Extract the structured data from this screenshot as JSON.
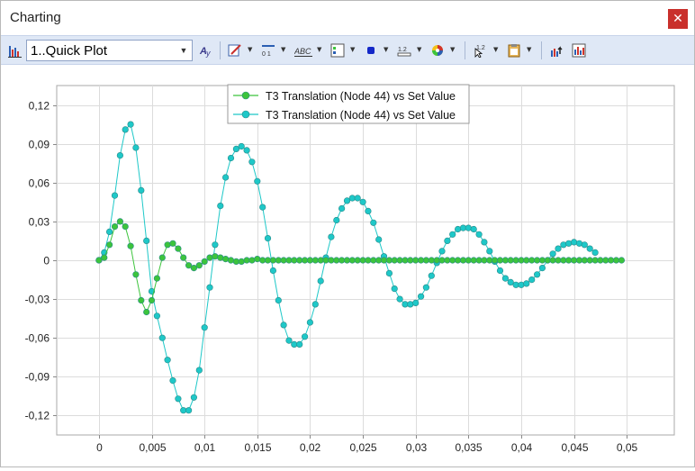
{
  "window": {
    "title": "Charting",
    "close_glyph": "✕"
  },
  "toolbar": {
    "chart_icon": "bar-chart-icon",
    "plot_select_value": "1..Quick Plot",
    "tools": [
      "font-style-icon",
      "edit-series-icon",
      "axis-format-icon",
      "abc-labels-icon",
      "legend-icon",
      "marker-style-icon",
      "number-format-icon",
      "color-palette-icon",
      "data-cursor-icon",
      "clipboard-icon",
      "export-icon",
      "chart-settings-icon"
    ]
  },
  "chart_data": {
    "type": "line",
    "xlim": [
      -0.004,
      0.0545
    ],
    "ylim": [
      -0.135,
      0.135
    ],
    "grid": true,
    "legend_position": "top-center",
    "x_ticks": [
      "0",
      "0,005",
      "0,01",
      "0,015",
      "0,02",
      "0,025",
      "0,03",
      "0,035",
      "0,04",
      "0,045",
      "0,05"
    ],
    "y_ticks": [
      "0,12",
      "0,09",
      "0,06",
      "0,03",
      "0",
      "-0,03",
      "-0,06",
      "-0,09",
      "-0,12"
    ],
    "series": [
      {
        "name": "T3 Translation (Node 44) vs Set Value",
        "color": "#3cc43c",
        "points": [
          [
            0,
            0
          ],
          [
            0.0005,
            0.002
          ],
          [
            0.001,
            0.012
          ],
          [
            0.0015,
            0.026
          ],
          [
            0.002,
            0.03
          ],
          [
            0.0025,
            0.026
          ],
          [
            0.003,
            0.011
          ],
          [
            0.0035,
            -0.011
          ],
          [
            0.004,
            -0.031
          ],
          [
            0.0045,
            -0.04
          ],
          [
            0.005,
            -0.031
          ],
          [
            0.0055,
            -0.014
          ],
          [
            0.006,
            0.002
          ],
          [
            0.0065,
            0.012
          ],
          [
            0.007,
            0.013
          ],
          [
            0.0075,
            0.009
          ],
          [
            0.008,
            0.002
          ],
          [
            0.0085,
            -0.004
          ],
          [
            0.009,
            -0.006
          ],
          [
            0.0095,
            -0.004
          ],
          [
            0.01,
            -0.001
          ],
          [
            0.0105,
            0.002
          ],
          [
            0.011,
            0.003
          ],
          [
            0.0115,
            0.002
          ],
          [
            0.012,
            0.001
          ],
          [
            0.0125,
            0
          ],
          [
            0.013,
            -0.001
          ],
          [
            0.0135,
            -0.001
          ],
          [
            0.014,
            0
          ],
          [
            0.0145,
            0
          ],
          [
            0.015,
            0.001
          ],
          [
            0.0155,
            0
          ],
          [
            0.016,
            0
          ],
          [
            0.0165,
            0
          ],
          [
            0.017,
            0
          ],
          [
            0.0175,
            0
          ],
          [
            0.018,
            0
          ],
          [
            0.0185,
            0
          ],
          [
            0.019,
            0
          ],
          [
            0.0195,
            0
          ],
          [
            0.02,
            0
          ],
          [
            0.0205,
            0
          ],
          [
            0.021,
            0
          ],
          [
            0.0215,
            0
          ],
          [
            0.022,
            0
          ],
          [
            0.0225,
            0
          ],
          [
            0.023,
            0
          ],
          [
            0.0235,
            0
          ],
          [
            0.024,
            0
          ],
          [
            0.0245,
            0
          ],
          [
            0.025,
            0
          ],
          [
            0.0255,
            0
          ],
          [
            0.026,
            0
          ],
          [
            0.0265,
            0
          ],
          [
            0.027,
            0
          ],
          [
            0.0275,
            0
          ],
          [
            0.028,
            0
          ],
          [
            0.0285,
            0
          ],
          [
            0.029,
            0
          ],
          [
            0.0295,
            0
          ],
          [
            0.03,
            0
          ],
          [
            0.0305,
            0
          ],
          [
            0.031,
            0
          ],
          [
            0.0315,
            0
          ],
          [
            0.032,
            0
          ],
          [
            0.0325,
            0
          ],
          [
            0.033,
            0
          ],
          [
            0.0335,
            0
          ],
          [
            0.034,
            0
          ],
          [
            0.0345,
            0
          ],
          [
            0.035,
            0
          ],
          [
            0.0355,
            0
          ],
          [
            0.036,
            0
          ],
          [
            0.0365,
            0
          ],
          [
            0.037,
            0
          ],
          [
            0.0375,
            0
          ],
          [
            0.038,
            0
          ],
          [
            0.0385,
            0
          ],
          [
            0.039,
            0
          ],
          [
            0.0395,
            0
          ],
          [
            0.04,
            0
          ],
          [
            0.0405,
            0
          ],
          [
            0.041,
            0
          ],
          [
            0.0415,
            0
          ],
          [
            0.042,
            0
          ],
          [
            0.0425,
            0
          ],
          [
            0.043,
            0
          ],
          [
            0.0435,
            0
          ],
          [
            0.044,
            0
          ],
          [
            0.0445,
            0
          ],
          [
            0.045,
            0
          ],
          [
            0.0455,
            0
          ],
          [
            0.046,
            0
          ],
          [
            0.0465,
            0
          ],
          [
            0.047,
            0
          ],
          [
            0.0475,
            0
          ],
          [
            0.048,
            0
          ],
          [
            0.0485,
            0
          ],
          [
            0.049,
            0
          ],
          [
            0.0495,
            0
          ]
        ]
      },
      {
        "name": "T3 Translation (Node 44) vs Set Value",
        "color": "#1ec8c8",
        "points": [
          [
            0,
            0
          ],
          [
            0.0005,
            0.006
          ],
          [
            0.001,
            0.022
          ],
          [
            0.0015,
            0.05
          ],
          [
            0.002,
            0.081
          ],
          [
            0.0025,
            0.101
          ],
          [
            0.003,
            0.105
          ],
          [
            0.0035,
            0.087
          ],
          [
            0.004,
            0.054
          ],
          [
            0.0045,
            0.015
          ],
          [
            0.005,
            -0.024
          ],
          [
            0.0055,
            -0.043
          ],
          [
            0.006,
            -0.06
          ],
          [
            0.0065,
            -0.077
          ],
          [
            0.007,
            -0.093
          ],
          [
            0.0075,
            -0.107
          ],
          [
            0.008,
            -0.116
          ],
          [
            0.0085,
            -0.116
          ],
          [
            0.009,
            -0.106
          ],
          [
            0.0095,
            -0.085
          ],
          [
            0.01,
            -0.052
          ],
          [
            0.0105,
            -0.021
          ],
          [
            0.011,
            0.012
          ],
          [
            0.0115,
            0.042
          ],
          [
            0.012,
            0.064
          ],
          [
            0.0125,
            0.079
          ],
          [
            0.013,
            0.086
          ],
          [
            0.0135,
            0.088
          ],
          [
            0.014,
            0.085
          ],
          [
            0.0145,
            0.076
          ],
          [
            0.015,
            0.061
          ],
          [
            0.0155,
            0.041
          ],
          [
            0.016,
            0.017
          ],
          [
            0.0165,
            -0.008
          ],
          [
            0.017,
            -0.031
          ],
          [
            0.0175,
            -0.05
          ],
          [
            0.018,
            -0.062
          ],
          [
            0.0185,
            -0.065
          ],
          [
            0.019,
            -0.065
          ],
          [
            0.0195,
            -0.059
          ],
          [
            0.02,
            -0.048
          ],
          [
            0.0205,
            -0.034
          ],
          [
            0.021,
            -0.016
          ],
          [
            0.0215,
            0.002
          ],
          [
            0.022,
            0.018
          ],
          [
            0.0225,
            0.031
          ],
          [
            0.023,
            0.04
          ],
          [
            0.0235,
            0.046
          ],
          [
            0.024,
            0.048
          ],
          [
            0.0245,
            0.048
          ],
          [
            0.025,
            0.045
          ],
          [
            0.0255,
            0.038
          ],
          [
            0.026,
            0.029
          ],
          [
            0.0265,
            0.016
          ],
          [
            0.027,
            0.003
          ],
          [
            0.0275,
            -0.01
          ],
          [
            0.028,
            -0.022
          ],
          [
            0.0285,
            -0.03
          ],
          [
            0.029,
            -0.034
          ],
          [
            0.0295,
            -0.034
          ],
          [
            0.03,
            -0.033
          ],
          [
            0.0305,
            -0.028
          ],
          [
            0.031,
            -0.021
          ],
          [
            0.0315,
            -0.012
          ],
          [
            0.032,
            -0.002
          ],
          [
            0.0325,
            0.007
          ],
          [
            0.033,
            0.015
          ],
          [
            0.0335,
            0.02
          ],
          [
            0.034,
            0.024
          ],
          [
            0.0345,
            0.025
          ],
          [
            0.035,
            0.025
          ],
          [
            0.0355,
            0.024
          ],
          [
            0.036,
            0.02
          ],
          [
            0.0365,
            0.014
          ],
          [
            0.037,
            0.007
          ],
          [
            0.0375,
            -0.001
          ],
          [
            0.038,
            -0.008
          ],
          [
            0.0385,
            -0.014
          ],
          [
            0.039,
            -0.017
          ],
          [
            0.0395,
            -0.019
          ],
          [
            0.04,
            -0.019
          ],
          [
            0.0405,
            -0.018
          ],
          [
            0.041,
            -0.015
          ],
          [
            0.0415,
            -0.011
          ],
          [
            0.042,
            -0.006
          ],
          [
            0.0425,
            0
          ],
          [
            0.043,
            0.005
          ],
          [
            0.0435,
            0.009
          ],
          [
            0.044,
            0.012
          ],
          [
            0.0445,
            0.013
          ],
          [
            0.045,
            0.014
          ],
          [
            0.0455,
            0.013
          ],
          [
            0.046,
            0.012
          ],
          [
            0.0465,
            0.009
          ],
          [
            0.047,
            0.006
          ]
        ]
      }
    ]
  }
}
